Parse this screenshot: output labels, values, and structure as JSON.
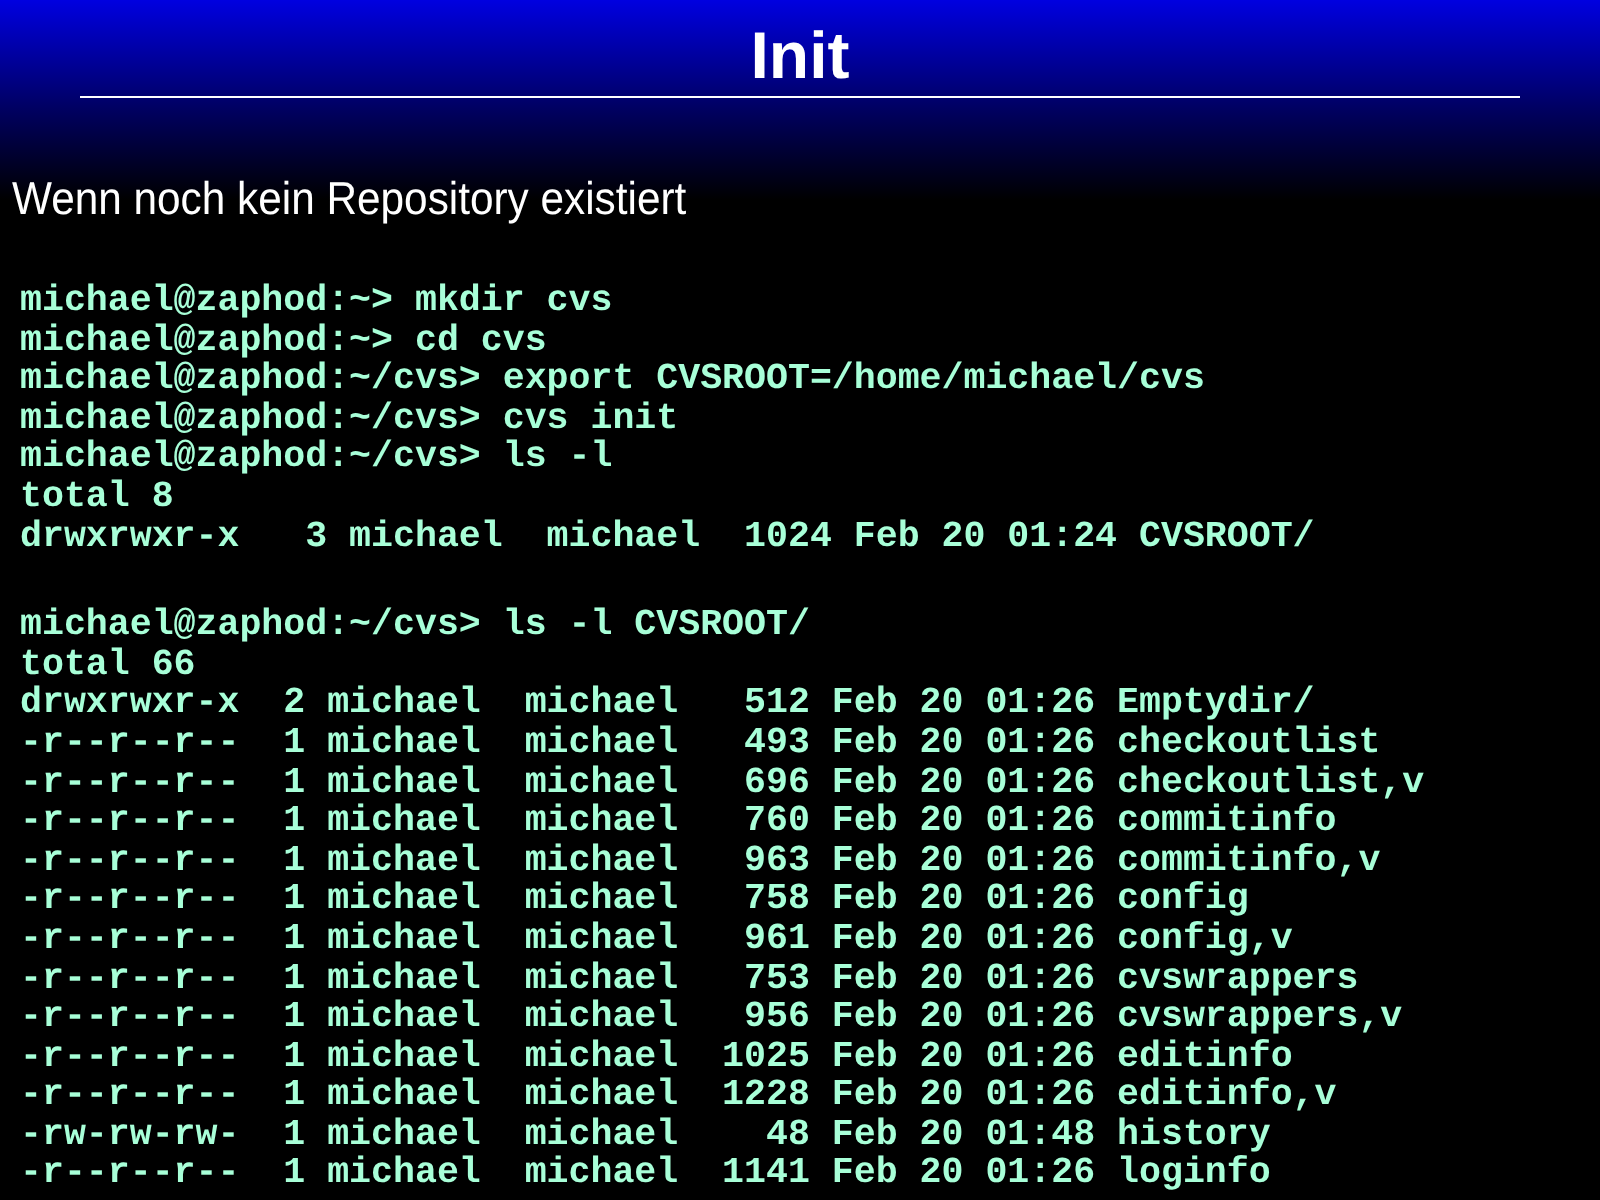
{
  "title": "Init",
  "subtitle": "Wenn noch kein Repository existiert",
  "terminal_blocks": [
    {
      "lines": [
        "michael@zaphod:~> mkdir cvs",
        "michael@zaphod:~> cd cvs",
        "michael@zaphod:~/cvs> export CVSROOT=/home/michael/cvs",
        "michael@zaphod:~/cvs> cvs init",
        "michael@zaphod:~/cvs> ls -l",
        "total 8",
        "drwxrwxr-x   3 michael  michael  1024 Feb 20 01:24 CVSROOT/"
      ]
    },
    {
      "lines": [
        "michael@zaphod:~/cvs> ls -l CVSROOT/",
        "total 66",
        "drwxrwxr-x  2 michael  michael   512 Feb 20 01:26 Emptydir/",
        "-r--r--r--  1 michael  michael   493 Feb 20 01:26 checkoutlist",
        "-r--r--r--  1 michael  michael   696 Feb 20 01:26 checkoutlist,v",
        "-r--r--r--  1 michael  michael   760 Feb 20 01:26 commitinfo",
        "-r--r--r--  1 michael  michael   963 Feb 20 01:26 commitinfo,v",
        "-r--r--r--  1 michael  michael   758 Feb 20 01:26 config",
        "-r--r--r--  1 michael  michael   961 Feb 20 01:26 config,v",
        "-r--r--r--  1 michael  michael   753 Feb 20 01:26 cvswrappers",
        "-r--r--r--  1 michael  michael   956 Feb 20 01:26 cvswrappers,v",
        "-r--r--r--  1 michael  michael  1025 Feb 20 01:26 editinfo",
        "-r--r--r--  1 michael  michael  1228 Feb 20 01:26 editinfo,v",
        "-rw-rw-rw-  1 michael  michael    48 Feb 20 01:48 history",
        "-r--r--r--  1 michael  michael  1141 Feb 20 01:26 loginfo"
      ]
    }
  ]
}
